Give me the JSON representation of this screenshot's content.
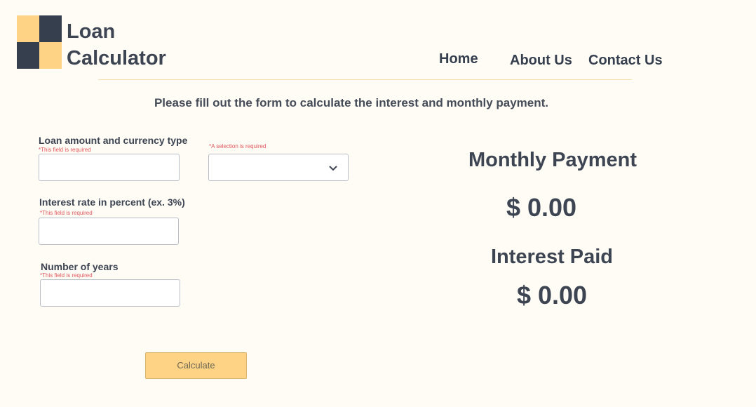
{
  "brand": {
    "line1": "Loan",
    "line2": "Calculator"
  },
  "nav": {
    "home": "Home",
    "about": "About Us",
    "contact": "Contact Us"
  },
  "instructions": "Please fill out the form to calculate the interest and monthly payment.",
  "form": {
    "loan_label": "Loan amount and currency type",
    "loan_required": "*This field is required",
    "loan_value": "",
    "currency_required": "*A selection is required",
    "currency_value": "",
    "rate_label": "Interest rate in percent (ex. 3%)",
    "rate_required": "*This field is required",
    "rate_value": "",
    "years_label": "Number of years",
    "years_required": "*This field is required",
    "years_value": "",
    "calculate_label": "Calculate"
  },
  "results": {
    "monthly_title": "Monthly Payment",
    "monthly_value": "$ 0.00",
    "interest_title": "Interest Paid",
    "interest_value": "$ 0.00"
  },
  "colors": {
    "accent": "#ffd385",
    "dark": "#353f4d",
    "background": "#fffcf6",
    "error": "#e0555a"
  },
  "icons": {
    "select": "chevron-down-icon"
  }
}
